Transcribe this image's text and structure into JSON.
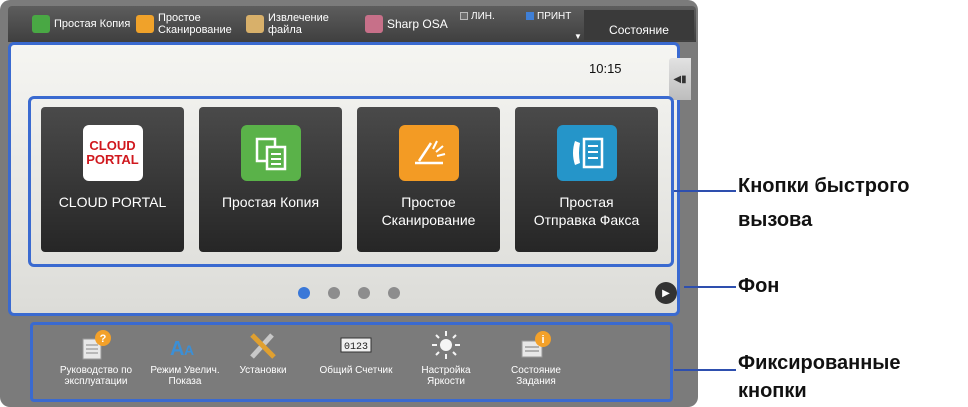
{
  "topbar": {
    "copy": "Простая Копия",
    "scan_line1": "Простое",
    "scan_line2": "Сканирование",
    "extract_line1": "Извлечение",
    "extract_line2": "файла",
    "osa": "Sharp OSA",
    "line_indicator": "ЛИН.",
    "print_indicator": "ПРИНТ",
    "status": "Состояние"
  },
  "main": {
    "clock": "10:15",
    "side_tab_icon": "collapse-arrow-icon",
    "quick_buttons": [
      {
        "label": "CLOUD PORTAL",
        "icon_text1": "CLOUD",
        "icon_text2": "PORTAL"
      },
      {
        "label": "Простая Копия"
      },
      {
        "label_line1": "Простое",
        "label_line2": "Сканирование"
      },
      {
        "label_line1": "Простая",
        "label_line2": "Отправка Факса"
      }
    ],
    "page_dots": 4,
    "active_dot": 1
  },
  "fixed_buttons": [
    {
      "line1": "Руководство по",
      "line2": "эксплуатации"
    },
    {
      "line1": "Режим Увелич.",
      "line2": "Показа"
    },
    {
      "line1": "Установки",
      "line2": ""
    },
    {
      "line1": "Общий Счетчик",
      "line2": ""
    },
    {
      "line1": "Настройка",
      "line2": "Яркости"
    },
    {
      "line1": "Состояние",
      "line2": "Задания"
    }
  ],
  "counter_digits": "0123",
  "annotations": {
    "quick_line1": "Кнопки быстрого",
    "quick_line2": "вызова",
    "background": "Фон",
    "fixed_line1": "Фиксированные",
    "fixed_line2": "кнопки"
  },
  "colors": {
    "highlight_border": "#3a6ad0",
    "active_dot": "#3a78d8"
  }
}
